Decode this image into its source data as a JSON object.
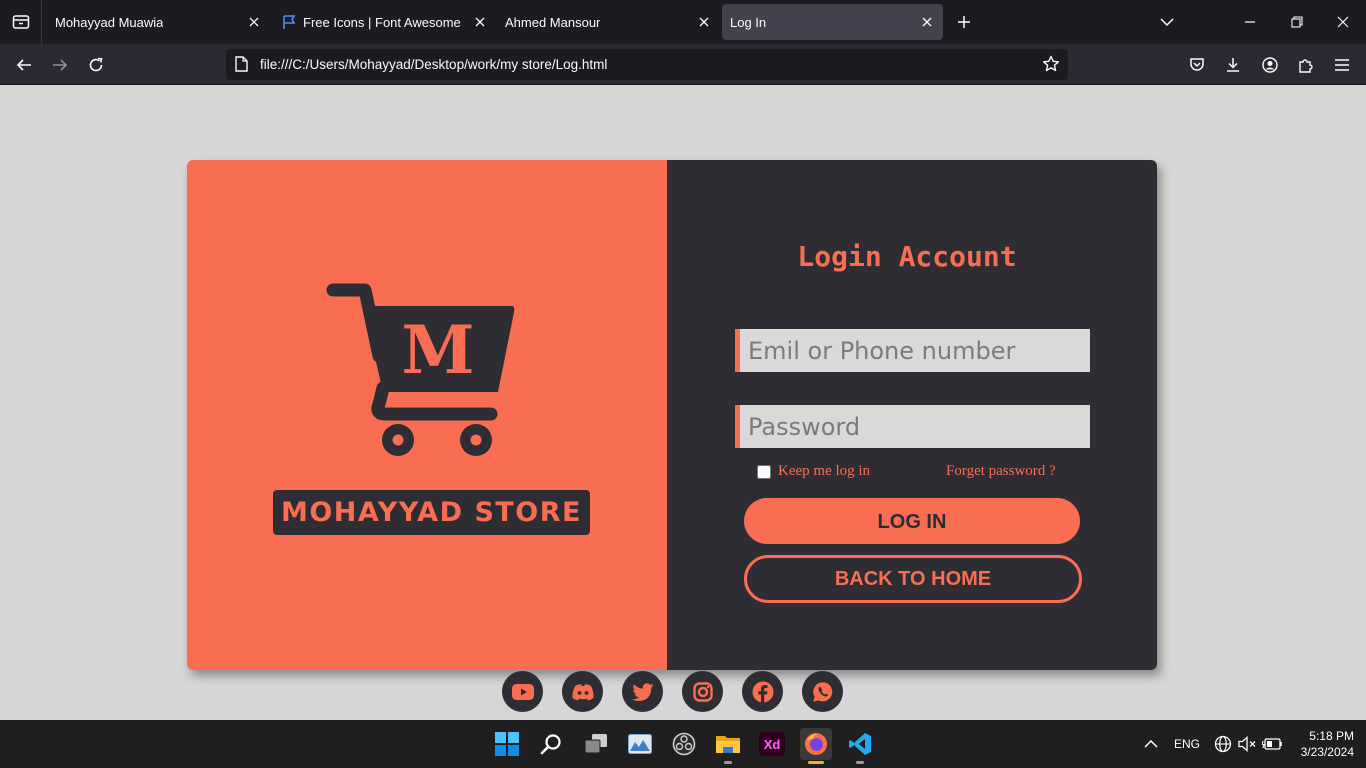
{
  "browser": {
    "tabs": [
      {
        "label": "Mohayyad Muawia",
        "active": false
      },
      {
        "label": "Free Icons | Font Awesome",
        "active": false
      },
      {
        "label": "Ahmed Mansour",
        "active": false
      },
      {
        "label": "Log In",
        "active": true
      }
    ],
    "url": "file:///C:/Users/Mohayyad/Desktop/work/my store/Log.html"
  },
  "page": {
    "store_name": "MOHAYYAD STORE",
    "logo_letter": "M",
    "login_title": "Login Account",
    "email_placeholder": "Emil or Phone number",
    "password_placeholder": "Password",
    "remember_label": "Keep me log in",
    "forget_label": "Forget password ?",
    "login_button": "LOG IN",
    "home_button": "BACK TO HOME",
    "social_icons": [
      "youtube-icon",
      "discord-icon",
      "twitter-icon",
      "instagram-icon",
      "facebook-icon",
      "whatsapp-icon"
    ],
    "colors": {
      "accent": "#f96e52",
      "dark": "#2e2d33",
      "background": "#d6d6d6"
    }
  },
  "taskbar": {
    "apps": [
      "windows-start-icon",
      "search-icon",
      "task-view-icon",
      "photos-icon",
      "obs-icon",
      "file-explorer-icon",
      "adobe-xd-icon",
      "firefox-icon",
      "vscode-icon"
    ],
    "language": "ENG",
    "time": "5:18 PM",
    "date": "3/23/2024"
  }
}
